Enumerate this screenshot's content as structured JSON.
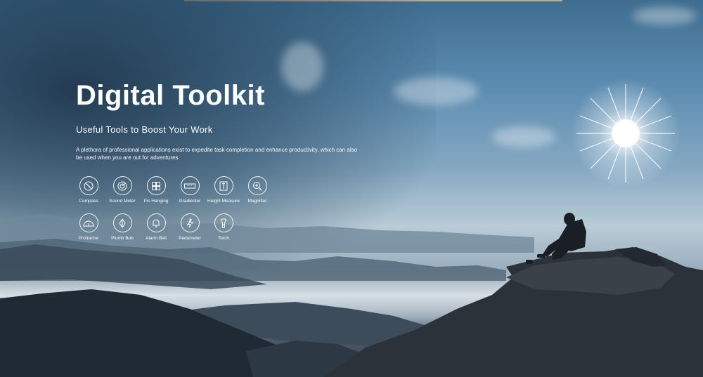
{
  "hero": {
    "title": "Digital Toolkit",
    "subtitle": "Useful Tools to Boost Your Work",
    "description": "A plethora of professional applications exist to expedite task completion and enhance productivity, which can also be used when you are out for adventures."
  },
  "tools": [
    {
      "label": "Compass",
      "icon": "compass-icon"
    },
    {
      "label": "Sound Meter",
      "icon": "sound-meter-icon"
    },
    {
      "label": "Pic Hanging",
      "icon": "pic-hanging-icon"
    },
    {
      "label": "Gradienter",
      "icon": "gradienter-icon"
    },
    {
      "label": "Height Measure",
      "icon": "height-measure-icon"
    },
    {
      "label": "Magnifier",
      "icon": "magnifier-icon"
    },
    {
      "label": "Protractor",
      "icon": "protractor-icon"
    },
    {
      "label": "Plumb Bob",
      "icon": "plumb-bob-icon"
    },
    {
      "label": "Alarm Bell",
      "icon": "alarm-bell-icon"
    },
    {
      "label": "Pedometer",
      "icon": "pedometer-icon"
    },
    {
      "label": "Torch",
      "icon": "torch-icon"
    }
  ],
  "colors": {
    "accent_bar": "#c9a47f",
    "text": "#ffffff",
    "sky_top": "#3f6d8f",
    "mountain_dark": "#2a3440"
  }
}
